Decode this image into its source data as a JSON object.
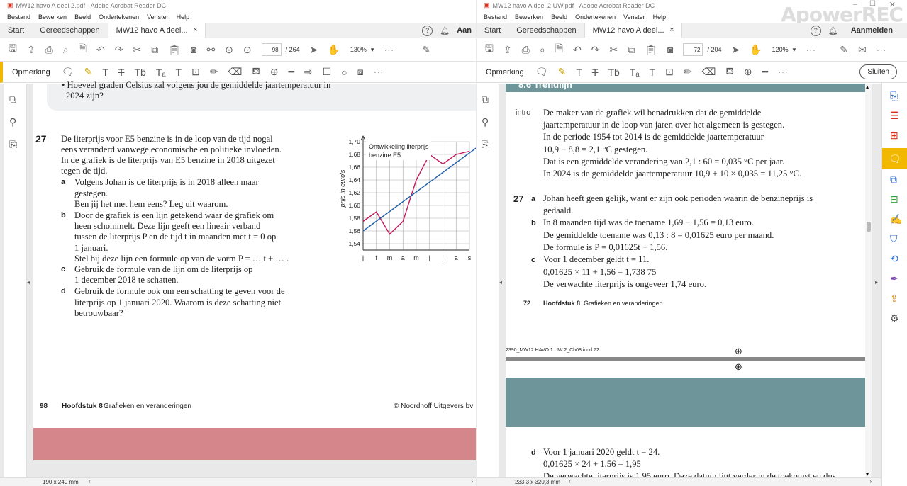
{
  "left": {
    "window_title": "MW12 havo A deel 2.pdf - Adobe Acrobat Reader DC",
    "menu": [
      "Bestand",
      "Bewerken",
      "Beeld",
      "Ondertekenen",
      "Venster",
      "Help"
    ],
    "tabs": {
      "start": "Start",
      "tools": "Gereedschappen",
      "doc": "MW12 havo A deel...",
      "close": "×",
      "account": "Aan"
    },
    "toolbar": {
      "page_current": "98",
      "page_total": "/ 264",
      "zoom": "130%"
    },
    "comment": {
      "label": "Opmerking"
    },
    "page": {
      "top_text": [
        "• Hoeveel graden Celsius zal volgens jou de gemiddelde jaartemperatuur in",
        "2024 zijn?"
      ],
      "exercise_number": "27",
      "intro": [
        "De literprijs voor E5 benzine is in de loop van de tijd nogal",
        "eens veranderd vanwege economische en politieke invloeden.",
        "In de grafiek is de literprijs van E5 benzine in 2018 uitgezet",
        "tegen de tijd."
      ],
      "items": [
        {
          "label": "a",
          "lines": [
            "Volgens Johan is de literprijs is in 2018 alleen maar",
            "gestegen.",
            "Ben jij het met hem eens? Leg uit waarom."
          ]
        },
        {
          "label": "b",
          "lines": [
            "Door de grafiek is een lijn getekend waar de grafiek om",
            "heen schommelt. Deze lijn geeft een lineair verband",
            "tussen de literprijs P en de tijd t in maanden met t = 0 op",
            "1 januari.",
            "Stel bij deze lijn een formule op van de vorm P = … t + … ."
          ]
        },
        {
          "label": "c",
          "lines": [
            "Gebruik de formule van de lijn om de literprijs op",
            "1 december 2018 te schatten."
          ]
        },
        {
          "label": "d",
          "lines": [
            "Gebruik de formule ook om een schatting te geven voor de",
            "literprijs op 1 januari 2020. Waarom is deze schatting niet",
            "betrouwbaar?"
          ]
        }
      ],
      "footer_page": "98",
      "footer_chapter": "Hoofdstuk 8",
      "footer_chapter_title": "Grafieken en veranderingen",
      "footer_copyright": "© Noordhoff Uitgevers bv"
    },
    "status": "190 x 240 mm",
    "colors": {
      "band": "#d4868a"
    }
  },
  "chart_data": {
    "type": "line",
    "title": "Ontwikkeling literprijs benzine E5",
    "ylabel": "prijs in euro's",
    "categories": [
      "j",
      "f",
      "m",
      "a",
      "m",
      "j",
      "j",
      "a",
      "s"
    ],
    "y_ticks": [
      "1,70",
      "1,68",
      "1,66",
      "1,64",
      "1,62",
      "1,60",
      "1,58",
      "1,56",
      "1,54"
    ],
    "ylim": [
      1.53,
      1.7
    ],
    "series": [
      {
        "color": "#c2185b",
        "values": [
          1.575,
          1.59,
          1.555,
          1.575,
          1.64,
          1.68,
          1.665,
          1.68,
          1.685
        ]
      },
      {
        "color": "#1f5fa8",
        "x": [
          0,
          8.5
        ],
        "values": [
          1.56,
          1.69
        ]
      }
    ]
  },
  "right": {
    "window_title": "MW12 havo A deel 2 UW.pdf - Adobe Acrobat Reader DC",
    "menu": [
      "Bestand",
      "Bewerken",
      "Beeld",
      "Ondertekenen",
      "Venster",
      "Help"
    ],
    "tabs": {
      "start": "Start",
      "tools": "Gereedschappen",
      "doc": "MW12 havo A deel...",
      "close": "×",
      "account": "Aanmelden"
    },
    "toolbar": {
      "page_current": "72",
      "page_total": "/ 204",
      "zoom": "120%"
    },
    "comment": {
      "label": "Opmerking",
      "close_button": "Sluiten"
    },
    "watermark": "ApowerREC",
    "page": {
      "header_partial": "8.6  Trendlijn",
      "intro_label": "intro",
      "intro": [
        "De maker van de grafiek wil benadrukken dat de gemiddelde",
        "jaartemperatuur in de loop van jaren over het algemeen is gestegen.",
        "In de periode 1954 tot 2014 is de gemiddelde jaartemperatuur",
        "10,9 − 8,8 = 2,1 °C gestegen.",
        "Dat is een gemiddelde verandering van 2,1 : 60 = 0,035 °C per jaar.",
        "In 2024 is de gemiddelde jaartemperatuur 10,9 + 10 × 0,035 = 11,25 °C."
      ],
      "exercise_number": "27",
      "answers": [
        {
          "label": "a",
          "lines": [
            "Johan heeft geen gelijk, want er zijn ook perioden waarin de benzineprijs is",
            "gedaald."
          ]
        },
        {
          "label": "b",
          "lines": [
            "In 8 maanden tijd was de toename 1,69 − 1,56 = 0,13 euro.",
            "De gemiddelde toename was 0,13 : 8 = 0,01625 euro per maand.",
            "De formule is P = 0,01625t + 1,56."
          ]
        },
        {
          "label": "c",
          "lines": [
            "Voor 1 december geldt t = 11.",
            "0,01625 × 11 + 1,56 = 1,738 75",
            "De verwachte literprijs is ongeveer 1,74 euro."
          ]
        }
      ],
      "footer_page": "72",
      "footer_chapter": "Hoofdstuk 8",
      "footer_chapter_title": "Grafieken en veranderingen",
      "indd": "2390_MW12 HAVO 1 UW 2_Ch08.indd   72",
      "next_label": "d",
      "next_lines": [
        "Voor 1 januari 2020 geldt t = 24.",
        "0,01625 × 24 + 1,56 = 1,95",
        "De verwachte literprijs is 1,95 euro. Deze datum ligt verder in de toekomst en dus"
      ]
    },
    "status": "233,3 x 320,3 mm",
    "colors": {
      "band": "#6e9599"
    }
  }
}
